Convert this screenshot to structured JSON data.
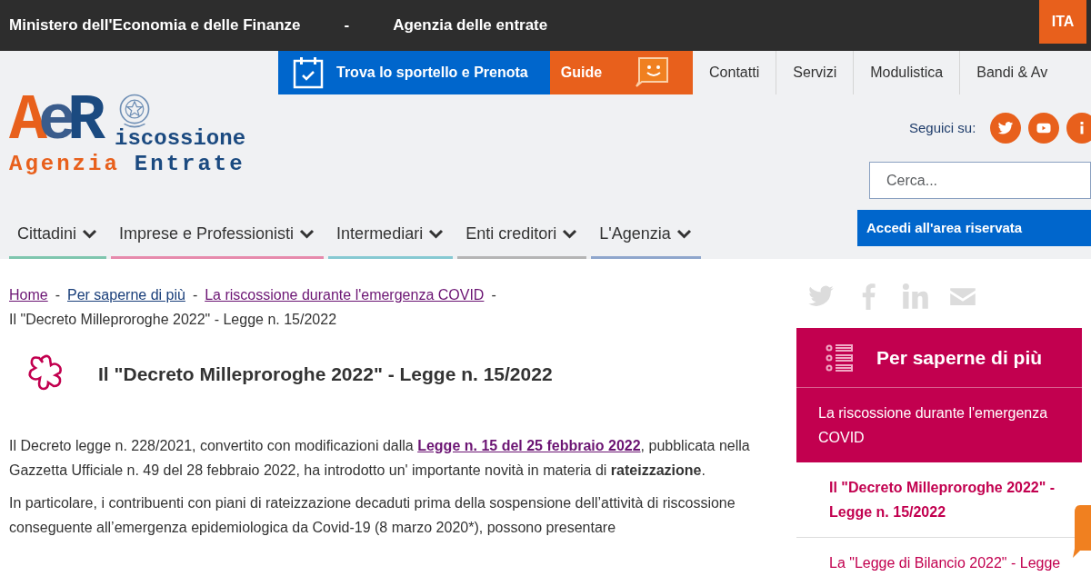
{
  "top_bar": {
    "items": [
      "Ministero dell'Economia e delle Finanze",
      "-",
      "Agenzia delle entrate"
    ],
    "language": "ITA"
  },
  "utility_links": [
    {
      "kind": "booking",
      "label": "Trova lo sportello e Prenota"
    },
    {
      "kind": "guide",
      "label": "Guide"
    },
    {
      "kind": "link",
      "label": "Contatti"
    },
    {
      "kind": "link",
      "label": "Servizi"
    },
    {
      "kind": "link",
      "label": "Modulistica"
    },
    {
      "kind": "link",
      "label": "Bandi & Av"
    }
  ],
  "logo": {
    "mark": "AeR",
    "word": "iscossione",
    "tagline_1": "Agenzia",
    "tagline_2": "Entrate"
  },
  "social": {
    "label": "Seguici su:"
  },
  "search": {
    "placeholder": "Cerca..."
  },
  "login_button": "Accedi all'area riservata",
  "main_nav": [
    {
      "label": "Cittadini",
      "color": "#7fc6ae"
    },
    {
      "label": "Imprese e Professionisti",
      "color": "#e68aac"
    },
    {
      "label": "Intermediari",
      "color": "#86c9d2"
    },
    {
      "label": "Enti creditori",
      "color": "#b5b5b5"
    },
    {
      "label": "L'Agenzia",
      "color": "#8fa6cc"
    }
  ],
  "breadcrumb": [
    {
      "label": "Home",
      "kind": "link",
      "visited": true,
      "separator": "-"
    },
    {
      "label": "Per saperne di più",
      "kind": "link",
      "visited": false,
      "separator": "-"
    },
    {
      "label": "La riscossione durante l'emergenza COVID",
      "kind": "link",
      "visited": true,
      "separator": "-"
    },
    {
      "label": "Il \"Decreto Milleproroghe 2022\" - Legge n. 15/2022",
      "kind": "current"
    }
  ],
  "article": {
    "title": "Il \"Decreto Milleproroghe 2022\" - Legge n. 15/2022",
    "intro": {
      "before": "Il Decreto legge n. 228/2021, convertito con modificazioni dalla ",
      "link": "Legge n. 15 del 25 febbraio 2022",
      "after": ", pubblicata nella Gazzetta Ufficiale n. 49 del 28 febbraio 2022, ha introdotto un' importante novità in materia di **rateizzazione**."
    },
    "paragraphs": [
      "In particolare, i contribuenti con piani di rateizzazione decaduti prima della sospensione dell’attività di riscossione conseguente all’emergenza epidemiologica da Covid-19 (8 marzo 2020*), possono presentare"
    ]
  },
  "sidebar": {
    "title": "Per saperne di più",
    "items": [
      {
        "kind": "parent",
        "label": "La riscossione durante l'emergenza COVID",
        "selected": false
      },
      {
        "kind": "child",
        "label": "Il \"Decreto Milleproroghe 2022\" - Legge n. 15/2022",
        "selected": true
      },
      {
        "kind": "child",
        "label": "La \"Legge di Bilancio 2022\" - Legge",
        "selected": false
      }
    ]
  }
}
